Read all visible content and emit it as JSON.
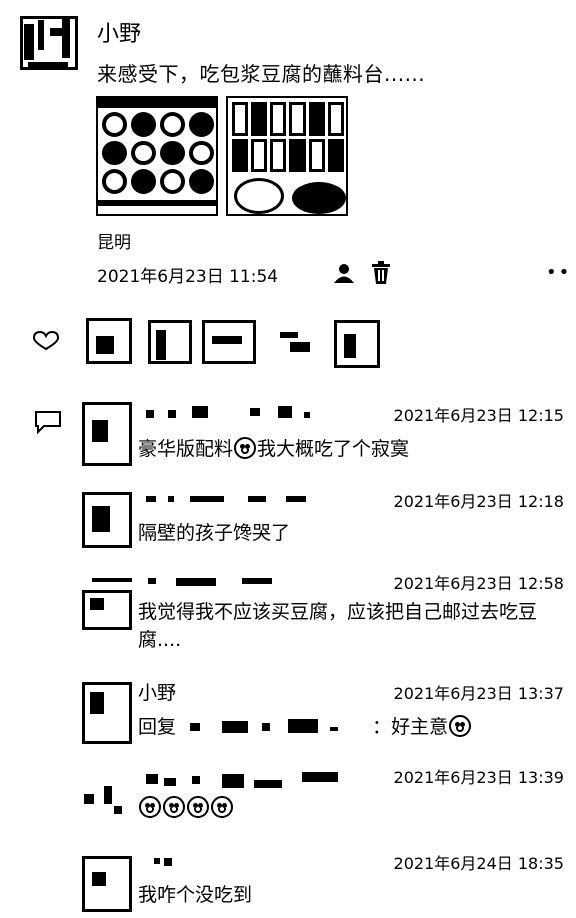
{
  "post": {
    "author": "小野",
    "text": "来感受下，吃包浆豆腐的蘸料台......",
    "location": "昆明",
    "timestamp": "2021年6月23日 11:54",
    "more_label": "••"
  },
  "comments": [
    {
      "name": "",
      "time": "2021年6月23日 12:15",
      "text_before": "豪华版配料",
      "text_after": "我大概吃了个寂寞"
    },
    {
      "name": "",
      "time": "2021年6月23日 12:18",
      "text": "隔壁的孩子馋哭了"
    },
    {
      "name": "",
      "time": "2021年6月23日 12:58",
      "text": "我觉得我不应该买豆腐，应该把自己邮过去吃豆腐...."
    },
    {
      "name": "小野",
      "time": "2021年6月23日 13:37",
      "reply_prefix": "回复",
      "reply_suffix": "：好主意"
    },
    {
      "name": "",
      "time": "2021年6月23日 13:39",
      "text": ""
    },
    {
      "name": "",
      "time": "2021年6月24日 18:35",
      "text": "我咋个没吃到"
    }
  ]
}
